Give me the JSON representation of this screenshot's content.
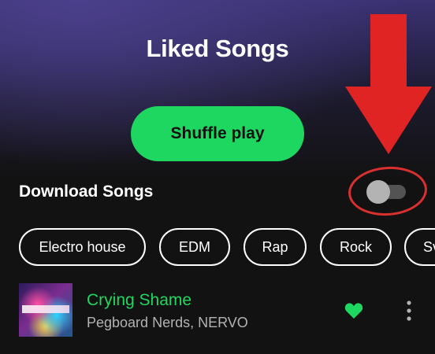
{
  "header": {
    "title": "Liked Songs"
  },
  "actions": {
    "shuffle_label": "Shuffle play"
  },
  "download": {
    "label": "Download Songs",
    "toggle_on": false
  },
  "annotation": {
    "color": "#d92f2f",
    "arrow_icon": "down-arrow-icon",
    "highlight": "ellipse"
  },
  "filters": [
    "Electro house",
    "EDM",
    "Rap",
    "Rock",
    "Sv"
  ],
  "tracks": [
    {
      "title": "Crying Shame",
      "artist": "Pegboard Nerds, NERVO",
      "liked": true
    }
  ],
  "colors": {
    "accent": "#1ed760",
    "background": "#121212",
    "secondary_text": "#b3b3b3"
  }
}
